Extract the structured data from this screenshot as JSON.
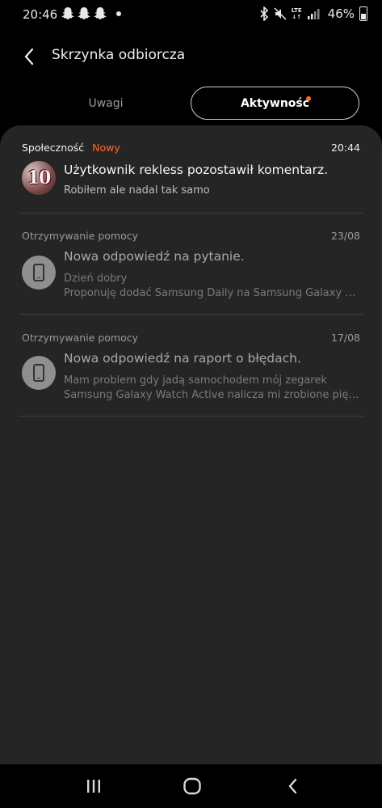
{
  "status_bar": {
    "time": "20:46",
    "network": "LTE",
    "battery_percent": "46%"
  },
  "header": {
    "title": "Skrzynka odbiorcza"
  },
  "tabs": [
    {
      "label": "Uwagi",
      "selected": false
    },
    {
      "label": "Aktywność",
      "selected": true,
      "has_new_dot": true
    }
  ],
  "items": [
    {
      "category": "Społeczność",
      "badge": "Nowy",
      "time": "20:44",
      "avatar_text": "10",
      "title": "Użytkownik rekless pozostawił komentarz.",
      "lines": [
        "Robiłem ale nadal tak samo"
      ]
    },
    {
      "category": "Otrzymywanie pomocy",
      "time": "23/08",
      "title": "Nowa odpowiedź na pytanie.",
      "lines": [
        "Dzień dobry",
        "Proponuję dodać Samsung Daily na Samsung Galaxy A…"
      ]
    },
    {
      "category": "Otrzymywanie pomocy",
      "time": "17/08",
      "title": "Nowa odpowiedź na raport o błędach.",
      "lines": [
        "Mam problem gdy jadą samochodem mój zegarek",
        "Samsung Galaxy Watch Active nalicza mi zrobione pię…"
      ]
    }
  ],
  "colors": {
    "accent": "#ff6a2c",
    "card_bg": "#252525",
    "page_bg": "#000000"
  },
  "icons": {
    "back": "back-arrow-icon",
    "phone": "phone-icon",
    "nav_recent": "recent-apps-icon",
    "nav_home": "home-icon",
    "nav_back": "back-icon"
  }
}
